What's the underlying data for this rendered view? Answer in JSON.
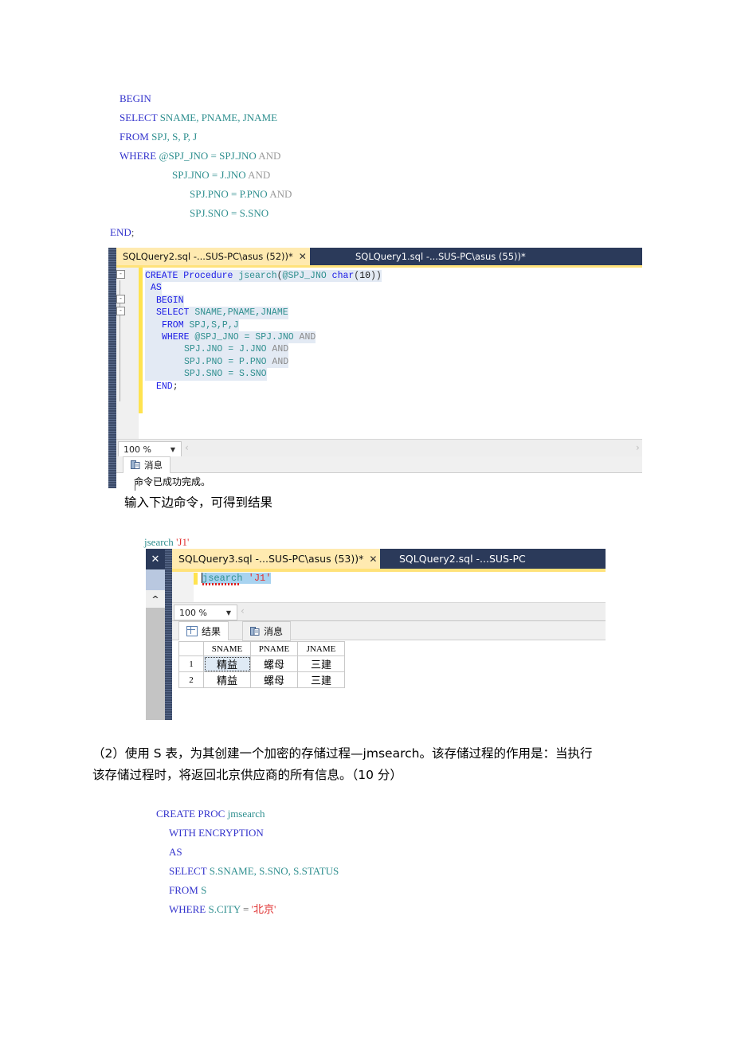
{
  "document": {
    "code_block_1": {
      "name": "jsearch-procedure-body",
      "lines": [
        {
          "indent": 0,
          "parts": [
            {
              "t": "BEGIN",
              "c": "kw"
            }
          ]
        },
        {
          "indent": 0,
          "parts": [
            {
              "t": "SELECT ",
              "c": "kw"
            },
            {
              "t": "SNAME, PNAME, JNAME",
              "c": "id"
            }
          ]
        },
        {
          "indent": 0,
          "parts": [
            {
              "t": "FROM ",
              "c": "kw"
            },
            {
              "t": "SPJ, S, P, J",
              "c": "id"
            }
          ]
        },
        {
          "indent": 0,
          "parts": [
            {
              "t": "WHERE ",
              "c": "kw"
            },
            {
              "t": "@SPJ_JNO = SPJ.JNO ",
              "c": "id"
            },
            {
              "t": "AND",
              "c": "dim"
            }
          ]
        },
        {
          "indent": 3,
          "parts": [
            {
              "t": "SPJ.JNO = J.JNO ",
              "c": "id"
            },
            {
              "t": "AND",
              "c": "dim"
            }
          ]
        },
        {
          "indent": 4,
          "parts": [
            {
              "t": "SPJ.PNO = P.PNO ",
              "c": "id"
            },
            {
              "t": "AND",
              "c": "dim"
            }
          ]
        },
        {
          "indent": 4,
          "parts": [
            {
              "t": "SPJ.SNO = S.SNO",
              "c": "id"
            }
          ]
        }
      ],
      "end_line": {
        "kw": "END",
        "pun": ";"
      }
    },
    "narrative_1": "输入下边命令，可得到结果",
    "inline_cmd": {
      "proc": "jsearch",
      "arg": "'J1'"
    },
    "question_2": "（2）使用 S 表，为其创建一个加密的存储过程—jmsearch。该存储过程的作用是：当执行该存储过程时，将返回北京供应商的所有信息。（10 分）",
    "question_2_line1": "（2）使用 S 表，为其创建一个加密的存储过程—jmsearch。该存储过程的作用是：当执行",
    "question_2_line2": "该存储过程时，将返回北京供应商的所有信息。（10 分）",
    "code_block_2": {
      "name": "jmsearch-create-proc",
      "lines": [
        {
          "indent": 0,
          "parts": [
            {
              "t": "CREATE PROC ",
              "c": "kw"
            },
            {
              "t": "jmsearch",
              "c": "id"
            }
          ]
        },
        {
          "indent": 1,
          "parts": [
            {
              "t": "WITH ENCRYPTION",
              "c": "kw"
            }
          ]
        },
        {
          "indent": 1,
          "parts": [
            {
              "t": "AS",
              "c": "kw"
            }
          ]
        },
        {
          "indent": 1,
          "parts": [
            {
              "t": "SELECT ",
              "c": "kw"
            },
            {
              "t": "S.SNAME, S.SNO, S.STATUS",
              "c": "id"
            }
          ]
        },
        {
          "indent": 1,
          "parts": [
            {
              "t": "FROM ",
              "c": "kw"
            },
            {
              "t": "S",
              "c": "id"
            }
          ]
        },
        {
          "indent": 1,
          "parts": [
            {
              "t": "WHERE ",
              "c": "kw"
            },
            {
              "t": "S.CITY ",
              "c": "id"
            },
            {
              "t": "= ",
              "c": "pun"
            },
            {
              "t": "'北京'",
              "c": "str"
            }
          ]
        }
      ]
    }
  },
  "ssms_window_1": {
    "tabs": [
      {
        "label": "SQLQuery2.sql -...SUS-PC\\asus (52))*",
        "active": true,
        "close_icon": "✕"
      },
      {
        "label": "SQLQuery1.sql -...SUS-PC\\asus (55))*",
        "active": false
      }
    ],
    "editor_lines": [
      {
        "fold": "minus",
        "indent": 0,
        "parts": [
          {
            "t": "CREATE Procedure ",
            "c": "kw"
          },
          {
            "t": "jsearch",
            "c": "id"
          },
          {
            "t": "(",
            "c": "pun"
          },
          {
            "t": "@SPJ_JNO ",
            "c": "id"
          },
          {
            "t": "char",
            "c": "kw"
          },
          {
            "t": "(",
            "c": "pun"
          },
          {
            "t": "10",
            "c": "num"
          },
          {
            "t": "))",
            "c": "pun"
          }
        ],
        "selected": true
      },
      {
        "fold": "",
        "indent": 1,
        "parts": [
          {
            "t": "AS",
            "c": "kw"
          }
        ],
        "selected": true
      },
      {
        "fold": "minus",
        "indent": 2,
        "parts": [
          {
            "t": "BEGIN",
            "c": "kw"
          }
        ],
        "selected": true
      },
      {
        "fold": "minus",
        "indent": 2,
        "parts": [
          {
            "t": "SELECT ",
            "c": "kw"
          },
          {
            "t": "SNAME,PNAME,JNAME",
            "c": "id"
          }
        ],
        "selected": true
      },
      {
        "fold": "",
        "indent": 3,
        "parts": [
          {
            "t": "FROM ",
            "c": "kw"
          },
          {
            "t": "SPJ,S,P,J",
            "c": "id"
          }
        ],
        "selected": true
      },
      {
        "fold": "",
        "indent": 3,
        "parts": [
          {
            "t": "WHERE ",
            "c": "kw"
          },
          {
            "t": "@SPJ_JNO = SPJ.JNO ",
            "c": "id"
          },
          {
            "t": "AND",
            "c": "dim"
          }
        ],
        "selected": true
      },
      {
        "fold": "",
        "indent": 7,
        "parts": [
          {
            "t": "SPJ.JNO = J.JNO ",
            "c": "id"
          },
          {
            "t": "AND",
            "c": "dim"
          }
        ],
        "selected": true
      },
      {
        "fold": "",
        "indent": 7,
        "parts": [
          {
            "t": "SPJ.PNO = P.PNO ",
            "c": "id"
          },
          {
            "t": "AND",
            "c": "dim"
          }
        ],
        "selected": true
      },
      {
        "fold": "",
        "indent": 7,
        "parts": [
          {
            "t": "SPJ.SNO = S.SNO",
            "c": "id"
          }
        ],
        "selected": true
      },
      {
        "fold": "",
        "indent": 2,
        "parts": [
          {
            "t": "END",
            "c": "kw"
          },
          {
            "t": ";",
            "c": "pun"
          }
        ],
        "selected": false
      }
    ],
    "zoom_level": "100 %",
    "zoom_caret_icon": "▼",
    "hscroll_left_icon": "‹",
    "hscroll_right_icon": "›",
    "messages_tab_label": "消息",
    "messages_tab_icon": "messages-icon",
    "message_text": "命令已成功完成。"
  },
  "ssms_window_2": {
    "close_icon": "✕",
    "collapse_caret_icon": "^",
    "tabs": [
      {
        "label": "SQLQuery3.sql -...SUS-PC\\asus (53))*",
        "active": true,
        "close_icon": "✕"
      },
      {
        "label": "SQLQuery2.sql -...SUS-PC",
        "active": false
      }
    ],
    "editor_line": {
      "proc": "jsearch",
      "arg": "'J1'"
    },
    "zoom_level": "100 %",
    "zoom_caret_icon": "▼",
    "hscroll_left_icon": "‹",
    "result_tabs": [
      {
        "label": "结果",
        "icon": "grid-icon",
        "active": true
      },
      {
        "label": "消息",
        "icon": "messages-icon",
        "active": false
      }
    ],
    "grid": {
      "columns": [
        "",
        "SNAME",
        "PNAME",
        "JNAME"
      ],
      "rows": [
        {
          "num": "1",
          "SNAME": "精益",
          "PNAME": "螺母",
          "JNAME": "三建",
          "focused_cell": "SNAME"
        },
        {
          "num": "2",
          "SNAME": "精益",
          "PNAME": "螺母",
          "JNAME": "三建",
          "focused_cell": ""
        }
      ]
    }
  },
  "colors": {
    "tab_active_bg": "#ffeab0",
    "tab_inactive_bg": "#2b3a5a",
    "tab_underline": "#ffe27a",
    "keyword_blue": "#1a1ae6",
    "identifier_teal": "#2f8f8f",
    "string_red": "#e03030",
    "selection_blue": "#a8d3f0",
    "editor_selection": "#e3eaf4",
    "change_bar_yellow": "#ffe34f"
  }
}
